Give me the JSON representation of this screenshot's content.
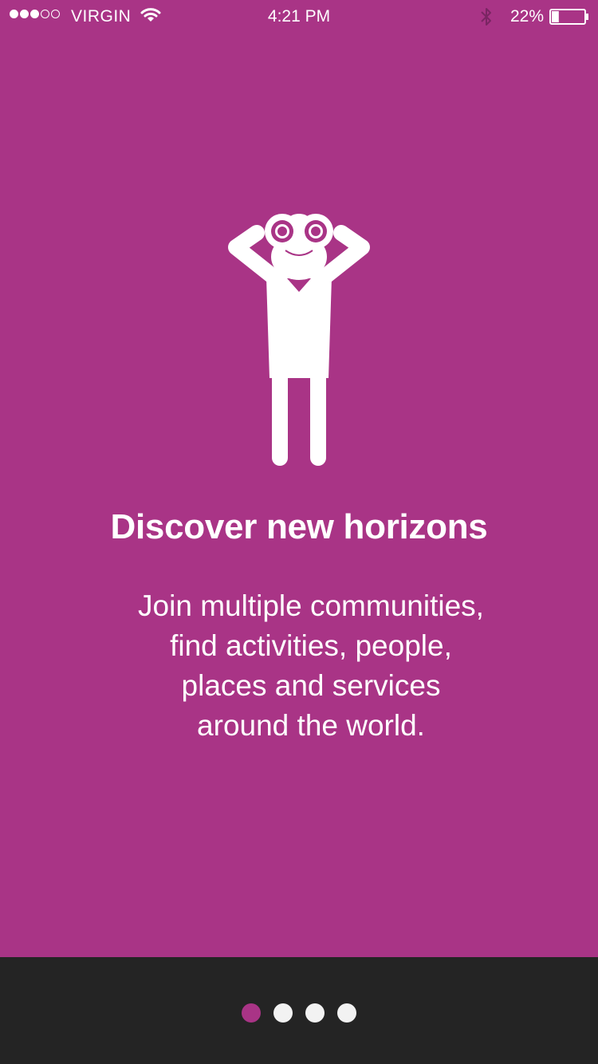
{
  "status_bar": {
    "carrier": "VIRGIN",
    "time": "4:21 PM",
    "battery_percent": "22%",
    "battery_level": 0.22,
    "signal_strength": 3,
    "signal_max": 5
  },
  "onboarding": {
    "illustration": "person-with-binoculars-icon",
    "title": "Discover new horizons",
    "description_lines": [
      "Join multiple communities,",
      "find activities, people,",
      "places and services",
      "around the world."
    ],
    "page_count": 4,
    "active_page": 1
  },
  "colors": {
    "primary": "#a93486",
    "bottom_bar": "#242424",
    "text": "#ffffff",
    "inactive_dot": "#f2f2f2"
  }
}
